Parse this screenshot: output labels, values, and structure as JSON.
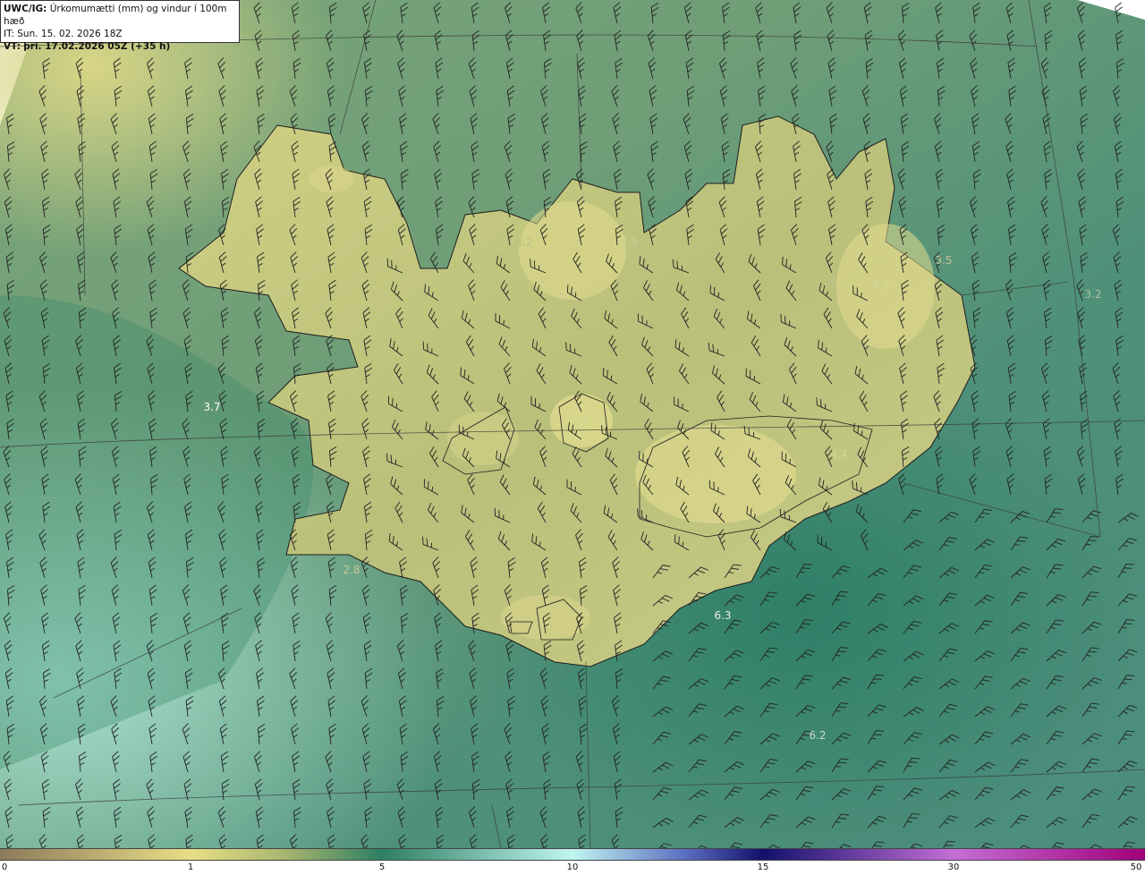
{
  "header": {
    "product_prefix": "UWC/IG:",
    "product_title": "Úrkomumætti (mm) og vindur í 100m hæð",
    "init_prefix": "IT:",
    "init_time": "Sun. 15. 02. 2026 18Z",
    "valid_prefix": "VT:",
    "valid_time": "þri. 17.02.2026 05Z (+35 h)"
  },
  "map_labels": [
    {
      "text": "4.2",
      "color": "#b9bf8a"
    },
    {
      "text": "3.9",
      "color": "#c9cf98"
    },
    {
      "text": "4.4",
      "color": "#d5d89a"
    },
    {
      "text": "3.5",
      "color": "#c6c99a"
    },
    {
      "text": "4.6",
      "color": "#d5d89a"
    },
    {
      "text": "3.2",
      "color": "#a9bfa0"
    },
    {
      "text": "3.7",
      "color": "#ffffff"
    },
    {
      "text": "4.4",
      "color": "#d5d89a"
    },
    {
      "text": "2.8",
      "color": "#c6c99a"
    },
    {
      "text": "6.3",
      "color": "#e9efe2"
    },
    {
      "text": "6.2",
      "color": "#c9d8cc"
    }
  ],
  "colorbar": {
    "ticks": [
      "0",
      "1",
      "5",
      "10",
      "15",
      "30",
      "50"
    ],
    "colors": {
      "c0": "#8b7a5a",
      "c1": "#e7df86",
      "c2": "#a7b56e",
      "c3": "#2e7f63",
      "c4": "#bff5f0",
      "c5": "#5a6cc0",
      "c6": "#12106b",
      "c7": "#c46fd6",
      "c8": "#a0007a"
    }
  }
}
